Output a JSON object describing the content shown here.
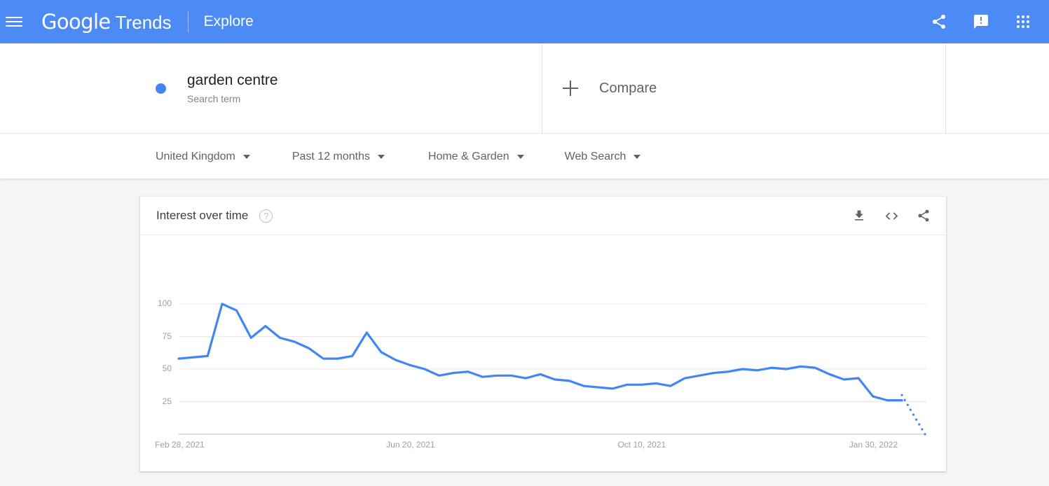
{
  "appbar": {
    "menu_icon": "hamburger-menu-icon",
    "logo_google": "Google",
    "logo_trends": "Trends",
    "section": "Explore",
    "actions": [
      {
        "name": "share-icon",
        "label": "Share"
      },
      {
        "name": "feedback-icon",
        "label": "Send feedback"
      },
      {
        "name": "google-apps-icon",
        "label": "Google apps"
      }
    ],
    "bg_color": "#4c8bf5"
  },
  "query": {
    "term": "garden centre",
    "type_label": "Search term",
    "dot_color": "#4285f4",
    "compare_label": "Compare"
  },
  "filters": [
    {
      "name": "location",
      "value": "United Kingdom"
    },
    {
      "name": "time-range",
      "value": "Past 12 months"
    },
    {
      "name": "category",
      "value": "Home & Garden"
    },
    {
      "name": "search-type",
      "value": "Web Search"
    }
  ],
  "card": {
    "title": "Interest over time",
    "help_glyph": "?",
    "actions": [
      {
        "name": "download-csv-icon",
        "label": "Download"
      },
      {
        "name": "embed-code-icon",
        "label": "Embed"
      },
      {
        "name": "share-chart-icon",
        "label": "Share"
      }
    ]
  },
  "chart_data": {
    "type": "line",
    "title": "Interest over time",
    "xlabel": "",
    "ylabel": "",
    "ylim": [
      0,
      108
    ],
    "yticks": [
      25,
      50,
      75,
      100
    ],
    "grid": true,
    "legend": false,
    "line_color": "#4285f4",
    "series_name": "garden centre",
    "xticks": [
      "Feb 28, 2021",
      "Jun 20, 2021",
      "Oct 10, 2021",
      "Jan 30, 2022"
    ],
    "xtick_index": [
      0,
      16,
      32,
      48
    ],
    "x": [
      "Feb 28, 2021",
      "Mar 7, 2021",
      "Mar 14, 2021",
      "Mar 21, 2021",
      "Mar 28, 2021",
      "Apr 4, 2021",
      "Apr 11, 2021",
      "Apr 18, 2021",
      "Apr 25, 2021",
      "May 2, 2021",
      "May 9, 2021",
      "May 16, 2021",
      "May 23, 2021",
      "May 30, 2021",
      "Jun 6, 2021",
      "Jun 13, 2021",
      "Jun 20, 2021",
      "Jun 27, 2021",
      "Jul 4, 2021",
      "Jul 11, 2021",
      "Jul 18, 2021",
      "Jul 25, 2021",
      "Aug 1, 2021",
      "Aug 8, 2021",
      "Aug 15, 2021",
      "Aug 22, 2021",
      "Aug 29, 2021",
      "Sep 5, 2021",
      "Sep 12, 2021",
      "Sep 19, 2021",
      "Sep 26, 2021",
      "Oct 3, 2021",
      "Oct 10, 2021",
      "Oct 17, 2021",
      "Oct 24, 2021",
      "Oct 31, 2021",
      "Nov 7, 2021",
      "Nov 14, 2021",
      "Nov 21, 2021",
      "Nov 28, 2021",
      "Dec 5, 2021",
      "Dec 12, 2021",
      "Dec 19, 2021",
      "Dec 26, 2021",
      "Jan 2, 2022",
      "Jan 9, 2022",
      "Jan 16, 2022",
      "Jan 23, 2022",
      "Jan 30, 2022",
      "Feb 6, 2022",
      "Feb 13, 2022"
    ],
    "values": [
      58,
      59,
      60,
      100,
      95,
      74,
      83,
      74,
      71,
      66,
      58,
      58,
      60,
      78,
      63,
      57,
      53,
      50,
      45,
      47,
      48,
      44,
      45,
      45,
      43,
      46,
      42,
      41,
      37,
      36,
      35,
      38,
      38,
      39,
      37,
      43,
      45,
      47,
      48,
      50,
      49,
      51,
      50,
      52,
      51,
      46,
      42,
      43,
      29,
      26,
      26
    ],
    "partial_tail": {
      "label": "partial data",
      "style": "dotted",
      "from_value": 30,
      "to_value": 0
    }
  }
}
